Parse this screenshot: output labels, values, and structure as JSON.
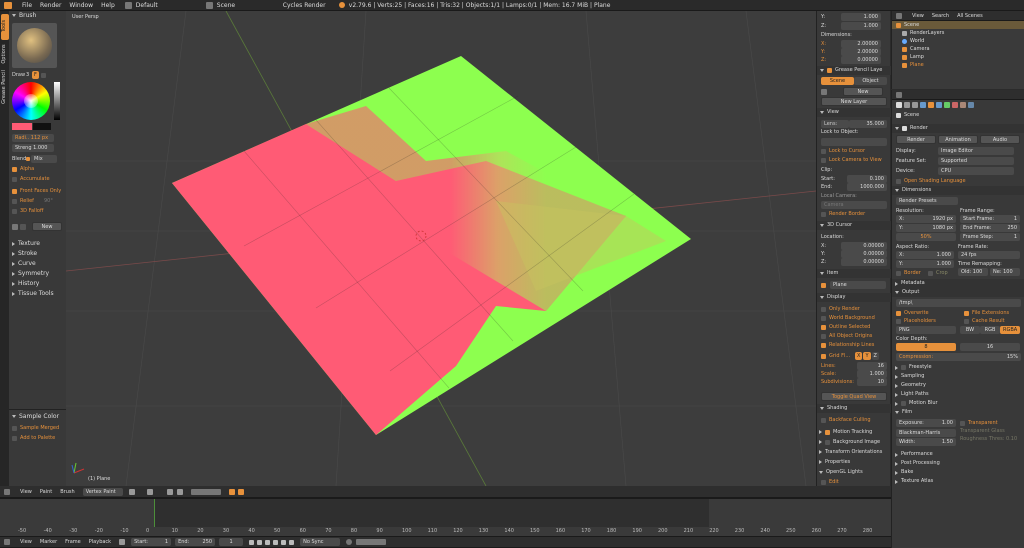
{
  "topbar": {
    "menus": [
      "File",
      "Render",
      "Window",
      "Help"
    ],
    "layout": "Default",
    "scene": "Scene",
    "engine": "Cycles Render",
    "stats": "v2.79.6 | Verts:25 | Faces:16 | Tris:32 | Objects:1/1 | Lamps:0/1 | Mem: 16.7 MiB | Plane"
  },
  "toolshelf": {
    "tabs": [
      "Tools",
      "Options",
      "Grease Pencil"
    ],
    "brush_header": "Brush",
    "draw_label": "Draw",
    "draw_count": "3",
    "draw_f": "F",
    "radius": "Radi.. 112 px",
    "strength": "Streng 1.000",
    "blend_label": "Blend:",
    "blend_value": "Mix",
    "alpha": "Alpha",
    "accumulate": "Accumulate",
    "front_faces": "Front Faces Only",
    "relief": "Relief",
    "relief_val": "90°",
    "relief3d": "3D Falloff",
    "new": "New",
    "sections": [
      "Texture",
      "Stroke",
      "Curve",
      "Symmetry",
      "History",
      "Tissue Tools"
    ],
    "sample_color": "Sample Color",
    "sample_merged": "Sample Merged",
    "add_palette": "Add to Palette"
  },
  "viewport": {
    "label": "User Persp",
    "object_label": "(1) Plane"
  },
  "npanel": {
    "top_vals": [
      {
        "k": "Y:",
        "v": "1.000"
      },
      {
        "k": "Z:",
        "v": "1.000"
      }
    ],
    "dimensions": "Dimensions:",
    "dims": [
      {
        "k": "X:",
        "v": "2.00000"
      },
      {
        "k": "Y:",
        "v": "2.00000"
      },
      {
        "k": "Z:",
        "v": "0.00000"
      }
    ],
    "gp_layer": "Grease Pencil Laye",
    "gp_scene": "Scene",
    "gp_object": "Object",
    "gp_new": "New",
    "gp_new_layer": "New Layer",
    "view": "View",
    "lens": "Lens:",
    "lens_val": "35.000",
    "lock_obj": "Lock to Object:",
    "lock_cursor": "Lock to Cursor",
    "lock_camera": "Lock Camera to View",
    "clip": "Clip:",
    "clip_start": "Start:",
    "clip_start_val": "0.100",
    "clip_end": "End:",
    "clip_end_val": "1000.000",
    "local_camera": "Local Camera:",
    "camera": "Camera",
    "render_border": "Render Border",
    "cursor3d": "3D Cursor",
    "location": "Location:",
    "cursor_vals": [
      {
        "k": "X:",
        "v": "0.00000"
      },
      {
        "k": "Y:",
        "v": "0.00000"
      },
      {
        "k": "Z:",
        "v": "0.00000"
      }
    ],
    "item": "Item",
    "item_name": "Plane",
    "display": "Display",
    "display_opts": [
      {
        "t": "Only Render",
        "on": false
      },
      {
        "t": "World Background",
        "on": false
      },
      {
        "t": "Outline Selected",
        "on": true
      },
      {
        "t": "All Object Origins",
        "on": false
      },
      {
        "t": "Relationship Lines",
        "on": true
      }
    ],
    "grid_floor": "Grid Fl...",
    "grid_xyz": [
      "X",
      "Y",
      "Z"
    ],
    "grid_vals": [
      {
        "k": "Lines:",
        "v": "16"
      },
      {
        "k": "Scale:",
        "v": "1.000"
      },
      {
        "k": "Subdivisions:",
        "v": "10"
      }
    ],
    "toggle_quad": "Toggle Quad View",
    "shading": "Shading",
    "backface": "Backface Culling",
    "sections": [
      "Motion Tracking",
      "Background Image",
      "Transform Orientations",
      "Properties",
      "OpenGL Lights"
    ],
    "edit": "Edit"
  },
  "outliner": {
    "menus": [
      "View",
      "Search"
    ],
    "filter": "All Scenes",
    "items": [
      "Scene",
      "RenderLayers",
      "World",
      "Camera",
      "Lamp",
      "Plane"
    ]
  },
  "properties": {
    "crumb": "Scene",
    "render_header": "Render",
    "render_btns": [
      "Render",
      "Animation",
      "Audio"
    ],
    "display_lbl": "Display:",
    "display_val": "Image Editor",
    "featureset_lbl": "Feature Set:",
    "featureset_val": "Supported",
    "device_lbl": "Device:",
    "device_val": "CPU",
    "osl": "Open Shading Language",
    "dimensions": "Dimensions",
    "presets": "Render Presets",
    "resolution": "Resolution:",
    "res_x": "X:",
    "res_x_val": "1920 px",
    "res_y": "Y:",
    "res_y_val": "1080 px",
    "res_pct": "50%",
    "frame_range": "Frame Range:",
    "start_frame": "Start Frame:",
    "start_frame_val": "1",
    "end_frame": "End Frame:",
    "end_frame_val": "250",
    "frame_step": "Frame Step:",
    "frame_step_val": "1",
    "aspect": "Aspect Ratio:",
    "asp_x": "X:",
    "asp_x_val": "1.000",
    "asp_y": "Y:",
    "asp_y_val": "1.000",
    "frame_rate": "Frame Rate:",
    "fps": "24 fps",
    "time_remap": "Time Remapping:",
    "old": "Old: 100",
    "new": "Ne: 100",
    "border": "Border",
    "crop": "Crop",
    "metadata": "Metadata",
    "output": "Output",
    "path": "/tmp\\",
    "overwrite": "Overwrite",
    "file_ext": "File Extensions",
    "placeholders": "Placeholders",
    "cache_result": "Cache Result",
    "format": "PNG",
    "bw": "BW",
    "rgb": "RGB",
    "rgba": "RGBA",
    "color_depth": "Color Depth:",
    "depth8": "8",
    "depth16": "16",
    "compression": "Compression:",
    "compression_val": "15%",
    "collapsed": [
      "Freestyle",
      "Sampling",
      "Geometry",
      "Light Paths",
      "Motion Blur"
    ],
    "film": "Film",
    "exposure": "Exposure:",
    "exposure_val": "1.00",
    "transparent": "Transparent",
    "transparent_glass": "Transparent Glass",
    "roughness": "Roughness Thres: 0.10",
    "filter": "Blackman-Harris",
    "width": "Width:",
    "width_val": "1.50",
    "bottom": [
      "Performance",
      "Post Processing",
      "Bake",
      "Texture Atlas"
    ]
  },
  "vpheader": {
    "menus": [
      "View",
      "Paint",
      "Brush"
    ],
    "mode": "Vertex Paint"
  },
  "timeline": {
    "ticks": [
      "-50",
      "-40",
      "-30",
      "-20",
      "-10",
      "0",
      "10",
      "20",
      "30",
      "40",
      "50",
      "60",
      "70",
      "80",
      "90",
      "100",
      "110",
      "120",
      "130",
      "140",
      "150",
      "160",
      "170",
      "180",
      "190",
      "200",
      "210",
      "220",
      "230",
      "240",
      "250",
      "260",
      "270",
      "280"
    ],
    "menus": [
      "View",
      "Marker",
      "Frame",
      "Playback"
    ],
    "start_lbl": "Start:",
    "start_val": "1",
    "end_lbl": "End:",
    "end_val": "250",
    "current": "1",
    "sync": "No Sync"
  },
  "colors": {
    "accent": "#e7913b",
    "green": "#8dff4f",
    "pink": "#ff5b75"
  }
}
